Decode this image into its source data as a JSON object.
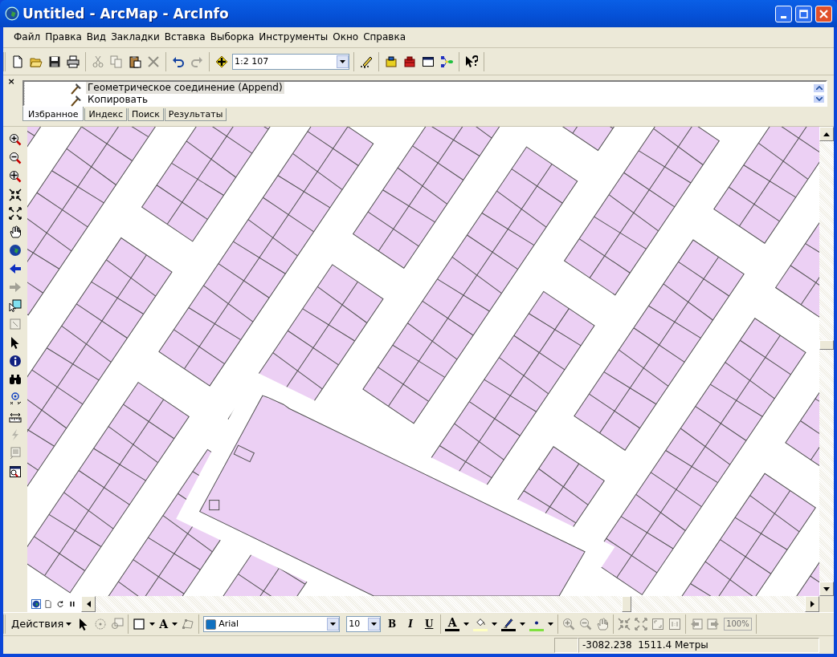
{
  "window": {
    "title": "Untitled - ArcMap - ArcInfo"
  },
  "menu": [
    "Файл",
    "Правка",
    "Вид",
    "Закладки",
    "Вставка",
    "Выборка",
    "Инструменты",
    "Окно",
    "Справка"
  ],
  "main_toolbar": [
    [
      {
        "kind": "new",
        "disabled": false
      },
      {
        "kind": "open",
        "disabled": false
      },
      {
        "kind": "save",
        "disabled": false
      },
      {
        "kind": "print",
        "disabled": false
      }
    ],
    [
      {
        "kind": "cut",
        "disabled": true
      },
      {
        "kind": "copy",
        "disabled": true
      },
      {
        "kind": "paste",
        "disabled": false
      },
      {
        "kind": "delete",
        "disabled": true
      }
    ],
    [
      {
        "kind": "undo",
        "disabled": false
      },
      {
        "kind": "redo",
        "disabled": true
      }
    ],
    [
      {
        "kind": "add-data",
        "disabled": false
      },
      {
        "kind": "combo",
        "value": "1:2 107"
      }
    ],
    [
      {
        "kind": "editor",
        "disabled": false
      }
    ],
    [
      {
        "kind": "toolbox-yellow",
        "disabled": false
      },
      {
        "kind": "toolbox-red",
        "disabled": false
      },
      {
        "kind": "command",
        "disabled": false
      },
      {
        "kind": "model",
        "disabled": false
      }
    ],
    [
      {
        "kind": "help",
        "disabled": false
      }
    ]
  ],
  "tool_panel": {
    "close": "×",
    "items": [
      {
        "label": "Геометрическое соединение (Append)",
        "selected": true
      },
      {
        "label": "Копировать",
        "selected": false
      }
    ],
    "tabs": [
      {
        "label": "Избранное",
        "selected": true
      },
      {
        "label": "Индекс",
        "selected": false
      },
      {
        "label": "Поиск",
        "selected": false
      },
      {
        "label": "Результаты",
        "selected": false
      }
    ]
  },
  "tools": [
    {
      "kind": "zoom-in",
      "disabled": false
    },
    {
      "kind": "zoom-out",
      "disabled": false
    },
    {
      "kind": "zoom-fixed",
      "disabled": false
    },
    {
      "kind": "arrows-in",
      "disabled": false
    },
    {
      "kind": "arrows-out",
      "disabled": false
    },
    {
      "kind": "hand",
      "disabled": false
    },
    {
      "kind": "globe",
      "disabled": false
    },
    {
      "kind": "back",
      "disabled": false
    },
    {
      "kind": "forward",
      "disabled": true
    },
    {
      "kind": "pointer-frame",
      "disabled": false
    },
    {
      "kind": "frame",
      "disabled": true
    },
    {
      "kind": "pointer",
      "disabled": false
    },
    {
      "kind": "info",
      "disabled": false
    },
    {
      "kind": "binoculars",
      "disabled": false
    },
    {
      "kind": "target",
      "disabled": false
    },
    {
      "kind": "ruler",
      "disabled": false
    },
    {
      "kind": "lightning",
      "disabled": true
    },
    {
      "kind": "note",
      "disabled": true
    },
    {
      "kind": "magnifier-window",
      "disabled": false
    }
  ],
  "view_buttons": [
    {
      "kind": "globe",
      "selected": true
    },
    {
      "kind": "page",
      "selected": false
    },
    {
      "kind": "refresh",
      "selected": false
    },
    {
      "kind": "pause",
      "selected": false
    }
  ],
  "draw_toolbar": [
    [
      {
        "kind": "menu",
        "label": "Действия"
      },
      {
        "kind": "pointer",
        "disabled": false
      },
      {
        "kind": "rotate",
        "disabled": true
      },
      {
        "kind": "zoom-selected",
        "disabled": true
      }
    ],
    [
      {
        "kind": "rectangle",
        "disabled": false,
        "caret": true
      },
      {
        "kind": "text",
        "label": "A",
        "disabled": false,
        "caret": true
      },
      {
        "kind": "vertices",
        "disabled": true
      }
    ],
    [
      {
        "kind": "font-combo",
        "value": "Arial"
      },
      {
        "kind": "size-combo",
        "value": "10"
      },
      {
        "kind": "bold",
        "label": "B",
        "disabled": false
      },
      {
        "kind": "italic",
        "label": "I",
        "disabled": false
      },
      {
        "kind": "underline",
        "label": "U",
        "disabled": false
      }
    ],
    [
      {
        "kind": "font-color",
        "label": "A",
        "color": "#000000",
        "caret": true
      },
      {
        "kind": "fill-color",
        "color": "#ffffc0",
        "caret": true
      },
      {
        "kind": "line-color",
        "color": "#000000",
        "caret": true
      },
      {
        "kind": "marker-color",
        "color": "#80e040",
        "caret": true
      }
    ],
    [
      {
        "kind": "layout-zoom-in",
        "disabled": true
      },
      {
        "kind": "layout-zoom-out",
        "disabled": true
      },
      {
        "kind": "layout-pan",
        "disabled": true
      }
    ],
    [
      {
        "kind": "arrows-in",
        "disabled": true
      },
      {
        "kind": "arrows-out",
        "disabled": true
      },
      {
        "kind": "full",
        "disabled": true
      },
      {
        "kind": "one-to-one",
        "disabled": true
      }
    ],
    [
      {
        "kind": "layout-back",
        "disabled": true
      },
      {
        "kind": "layout-forward",
        "disabled": true
      },
      {
        "kind": "zoom-percent",
        "value": "100%",
        "disabled": true
      }
    ]
  ],
  "status_bar": {
    "coordinates": "-3082.238  1511.4 Метры"
  }
}
